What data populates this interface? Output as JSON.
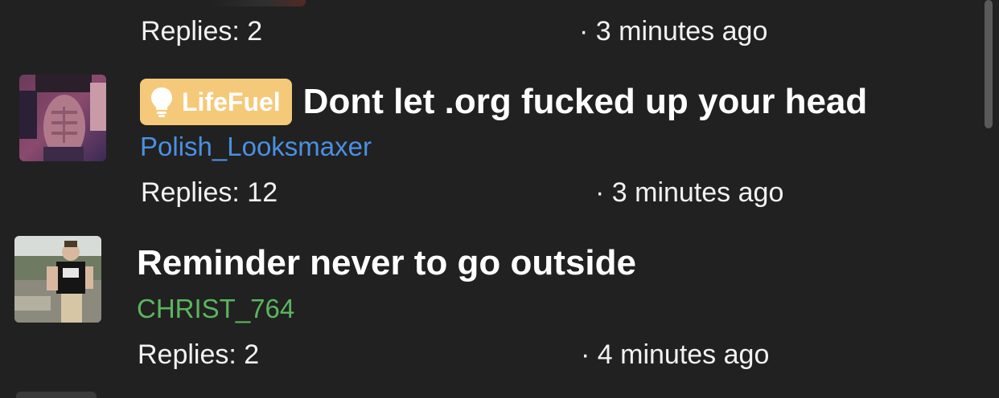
{
  "previous_thread": {
    "replies": "Replies: 2",
    "time": "· 3 minutes ago"
  },
  "threads": [
    {
      "prefix": {
        "label": "LifeFuel",
        "icon": "lightbulb-icon",
        "color": "#f5c97a"
      },
      "title": "Dont let .org fucked up your head",
      "author": "Polish_Looksmaxer",
      "author_color": "#4a90e2",
      "replies": "Replies: 12",
      "time": "· 3 minutes ago"
    },
    {
      "title": "Reminder never to go outside",
      "author": "CHRIST_764",
      "author_color": "#5cb55e",
      "replies": "Replies: 2",
      "time": "· 4 minutes ago"
    }
  ],
  "colors": {
    "background": "#212121",
    "text": "#ffffff"
  }
}
